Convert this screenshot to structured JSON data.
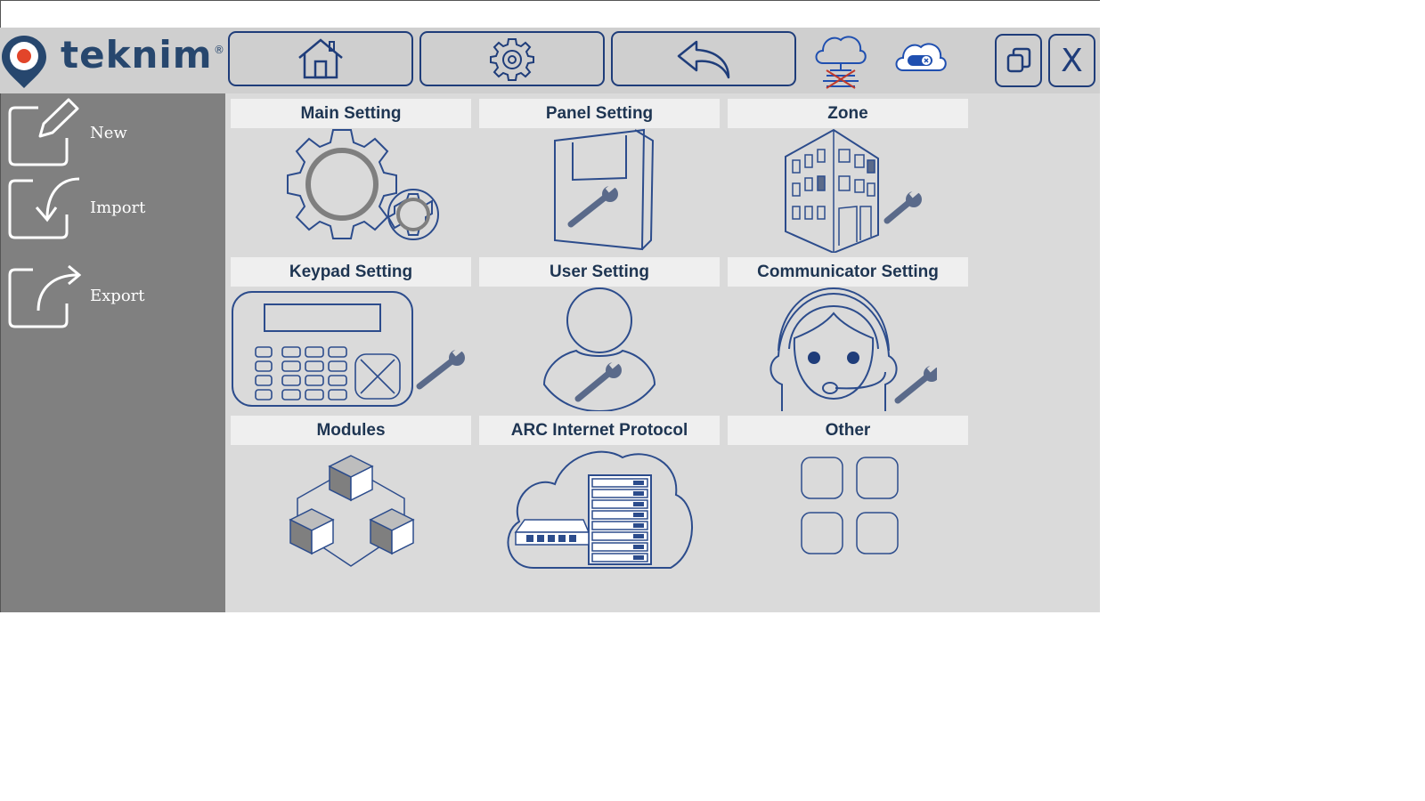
{
  "brand": {
    "logo_text": "teknim",
    "registered_mark": "®"
  },
  "toolbar": {
    "buttons": [
      {
        "name": "home",
        "icon": "home-icon"
      },
      {
        "name": "settings",
        "icon": "gear-icon"
      },
      {
        "name": "back",
        "icon": "back-arrow-icon"
      }
    ],
    "cloud_status": {
      "icon": "cloud-disconnected-icon"
    },
    "cloud_toggle": {
      "icon": "cloud-toggle-icon"
    },
    "restore_icon": "restore-window-icon",
    "close_label": "X"
  },
  "sidebar": {
    "items": [
      {
        "label": "New",
        "icon": "edit-icon"
      },
      {
        "label": "Import",
        "icon": "import-icon"
      },
      {
        "label": "Export",
        "icon": "export-icon"
      }
    ]
  },
  "tiles": [
    {
      "label": "Main Setting",
      "icon": "gears-icon"
    },
    {
      "label": "Panel Setting",
      "icon": "panel-wrench-icon"
    },
    {
      "label": "Zone",
      "icon": "building-wrench-icon"
    },
    {
      "label": "Keypad Setting",
      "icon": "keypad-wrench-icon"
    },
    {
      "label": "User Setting",
      "icon": "user-wrench-icon"
    },
    {
      "label": "Communicator Setting",
      "icon": "operator-headset-icon"
    },
    {
      "label": "Modules",
      "icon": "cubes-icon"
    },
    {
      "label": "ARC Internet Protocol",
      "icon": "cloud-server-icon"
    },
    {
      "label": "Other",
      "icon": "grid-icon"
    }
  ],
  "colors": {
    "accent": "#1f3d7a",
    "topbar_bg": "#cfcfcf",
    "sidebar_bg": "#808080",
    "main_bg": "#dadada",
    "tile_header_bg": "#efefef",
    "logo_red": "#e2452a"
  }
}
